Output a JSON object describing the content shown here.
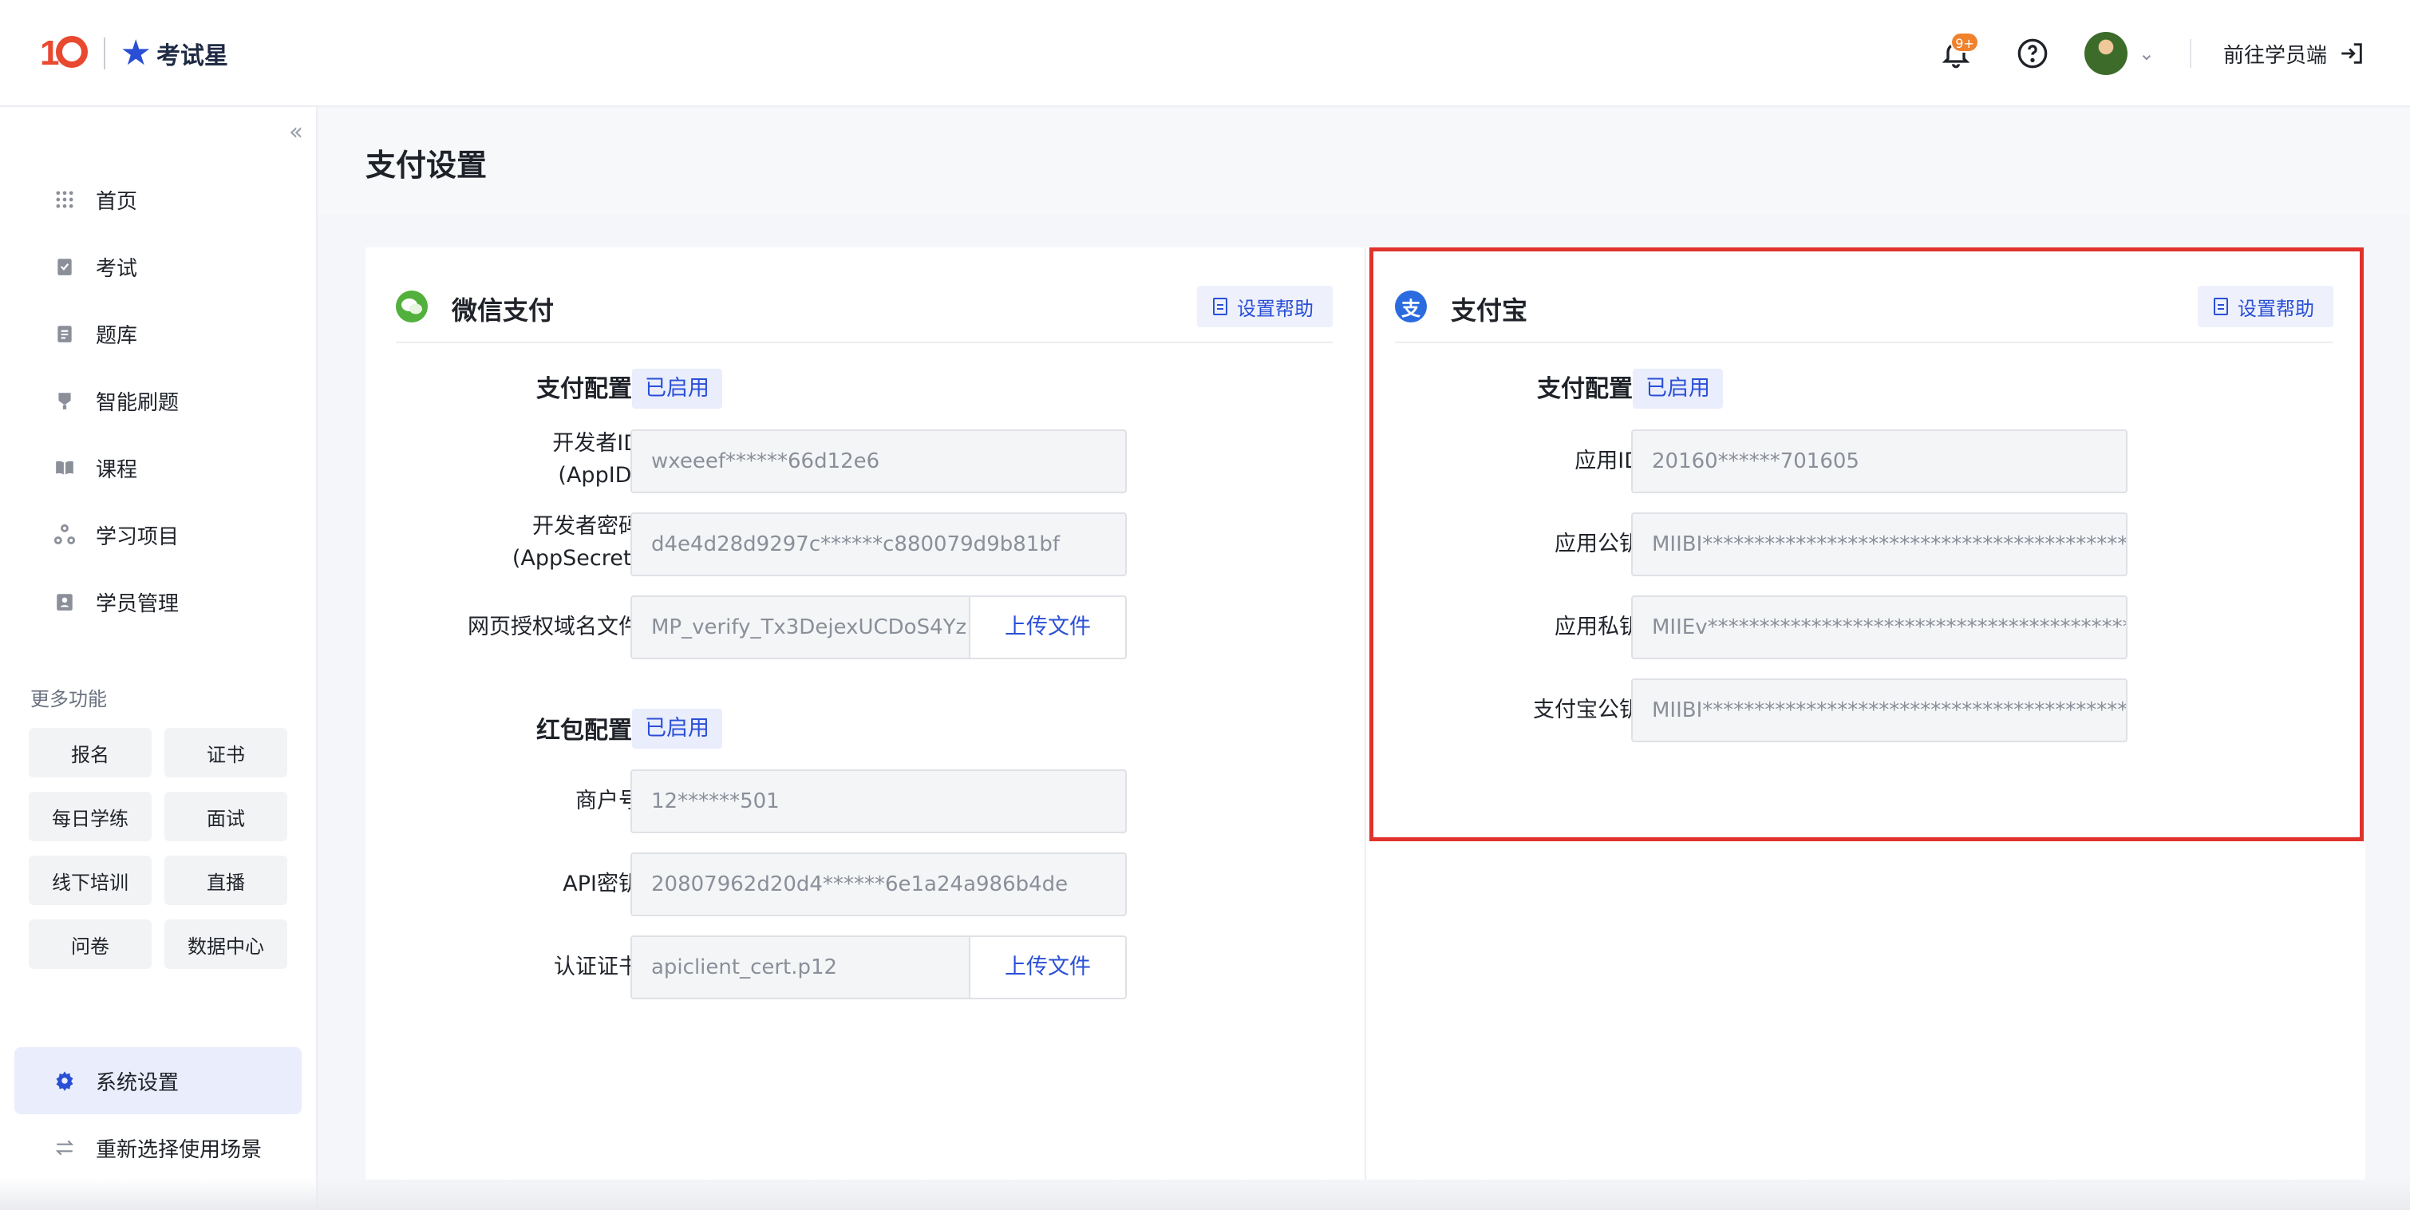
{
  "topbar": {
    "brand_name": "考试星",
    "notification_badge": "9+",
    "goto_student": "前往学员端"
  },
  "sidebar": {
    "items": [
      {
        "label": "首页",
        "icon": "grid-icon"
      },
      {
        "label": "考试",
        "icon": "clipboard-icon"
      },
      {
        "label": "题库",
        "icon": "book-list-icon"
      },
      {
        "label": "智能刷题",
        "icon": "brush-icon"
      },
      {
        "label": "课程",
        "icon": "open-book-icon"
      },
      {
        "label": "学习项目",
        "icon": "project-icon"
      },
      {
        "label": "学员管理",
        "icon": "student-icon"
      }
    ],
    "more_title": "更多功能",
    "more_items": [
      "报名",
      "证书",
      "每日学练",
      "面试",
      "线下培训",
      "直播",
      "问卷",
      "数据中心"
    ],
    "bottom_items": [
      {
        "label": "系统设置",
        "icon": "gear-icon",
        "active": true
      },
      {
        "label": "重新选择使用场景",
        "icon": "swap-icon",
        "active": false
      }
    ]
  },
  "page": {
    "title": "支付设置"
  },
  "wechat": {
    "title": "微信支付",
    "help": "设置帮助",
    "pay_config_label": "支付配置:",
    "pay_config_status": "已启用",
    "appid_label_1": "开发者ID",
    "appid_label_2": "(AppID)",
    "appid_value": "wxeeef******66d12e6",
    "secret_label_1": "开发者密码",
    "secret_label_2": "(AppSecret)",
    "secret_value": "d4e4d28d9297c******c880079d9b81bf",
    "domain_file_label": "网页授权域名文件",
    "domain_file_value": "MP_verify_Tx3DejexUCDoS4Yz.",
    "upload_label": "上传文件",
    "redpack_label": "红包配置:",
    "redpack_status": "已启用",
    "merchant_label": "商户号",
    "merchant_value": "12******501",
    "api_key_label": "API密钥",
    "api_key_value": "20807962d20d4******6e1a24a986b4de",
    "cert_label": "认证证书",
    "cert_value": "apiclient_cert.p12",
    "cert_upload_label": "上传文件"
  },
  "alipay": {
    "title": "支付宝",
    "logo_glyph": "支",
    "help": "设置帮助",
    "pay_config_label": "支付配置:",
    "pay_config_status": "已启用",
    "app_id_label": "应用ID",
    "app_id_value": "20160******701605",
    "app_pub_label": "应用公钥",
    "app_pub_value": "MIIBI*************************************************",
    "app_priv_label": "应用私钥",
    "app_priv_value": "MIIEv*************************************************",
    "ali_pub_label": "支付宝公钥",
    "ali_pub_value": "MIIBI*************************************************"
  },
  "colors": {
    "accent": "#2a4fd6",
    "highlight_border": "#e0322b",
    "badge": "#f0822d",
    "wechat_green": "#52b03c",
    "alipay_blue": "#2a6be0"
  }
}
